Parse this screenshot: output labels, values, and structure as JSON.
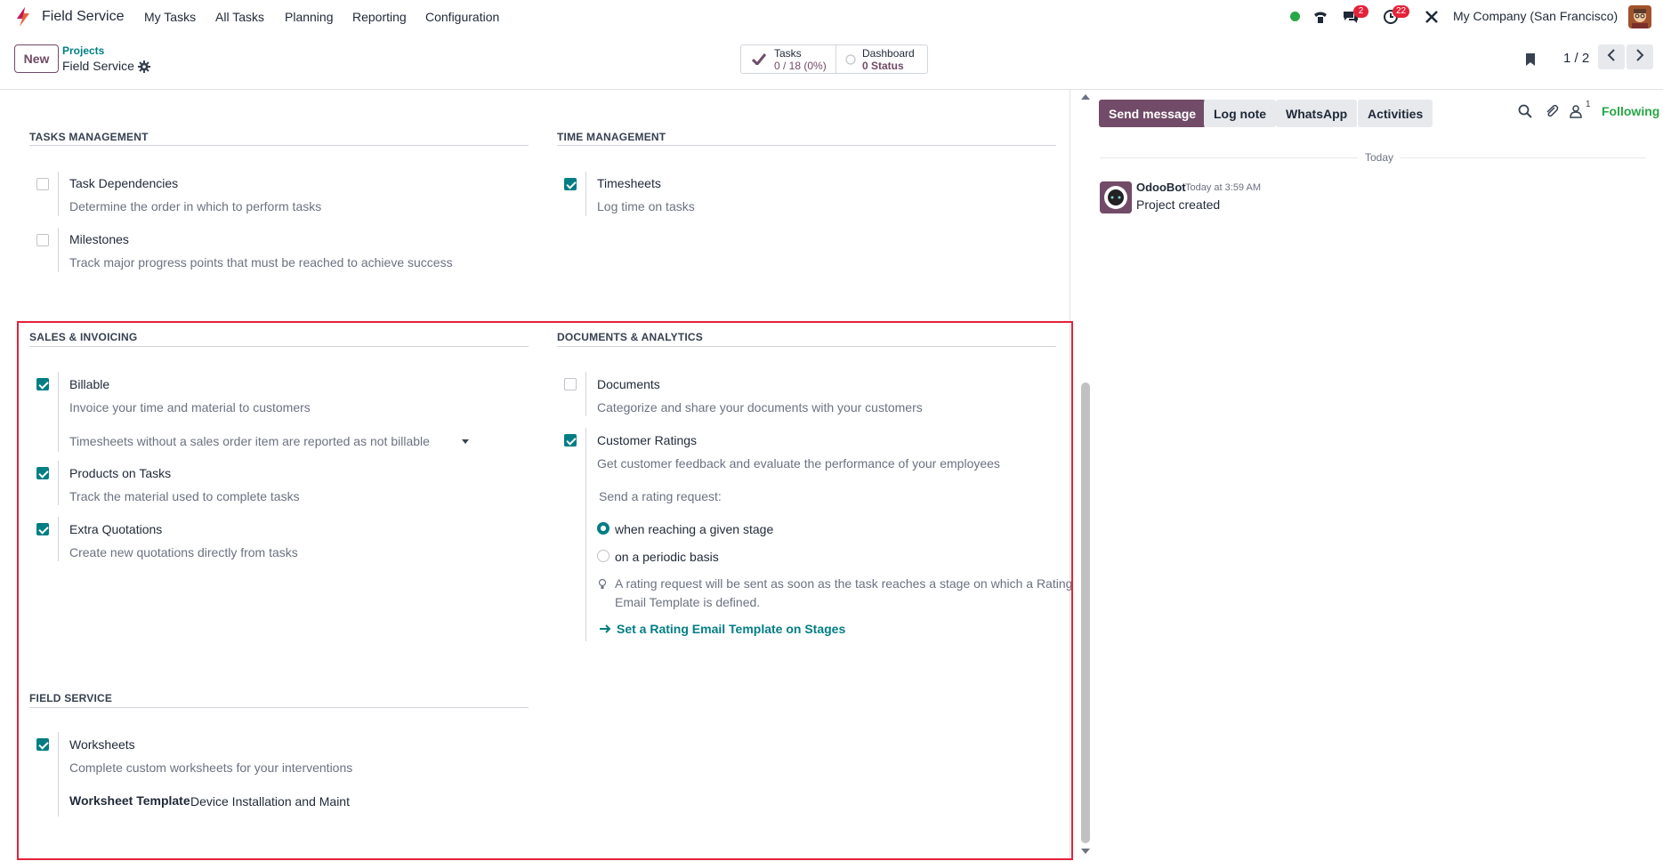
{
  "navbar": {
    "app_name": "Field Service",
    "menus": [
      "My Tasks",
      "All Tasks",
      "Planning",
      "Reporting",
      "Configuration"
    ],
    "messages_badge": "2",
    "activities_badge": "22",
    "company": "My Company (San Francisco)"
  },
  "control": {
    "new_label": "New",
    "breadcrumb_parent": "Projects",
    "breadcrumb_current": "Field Service",
    "tasks_label": "Tasks",
    "tasks_value": "0 / 18 (0%)",
    "dashboard_label": "Dashboard",
    "dashboard_value": "0 Status",
    "pager": "1 / 2"
  },
  "sections": {
    "tasks_management": {
      "title": "TASKS MANAGEMENT",
      "task_dependencies": {
        "title": "Task Dependencies",
        "desc": "Determine the order in which to perform tasks",
        "checked": false
      },
      "milestones": {
        "title": "Milestones",
        "desc": "Track major progress points that must be reached to achieve success",
        "checked": false
      }
    },
    "time_management": {
      "title": "TIME MANAGEMENT",
      "timesheets": {
        "title": "Timesheets",
        "desc": "Log time on tasks",
        "checked": true
      }
    },
    "sales_invoicing": {
      "title": "SALES & INVOICING",
      "billable": {
        "title": "Billable",
        "desc": "Invoice your time and material to customers",
        "checked": true,
        "select_value": "Timesheets without a sales order item are reported as not billable"
      },
      "products_on_tasks": {
        "title": "Products on Tasks",
        "desc": "Track the material used to complete tasks",
        "checked": true
      },
      "extra_quotations": {
        "title": "Extra Quotations",
        "desc": "Create new quotations directly from tasks",
        "checked": true
      }
    },
    "documents_analytics": {
      "title": "DOCUMENTS & ANALYTICS",
      "documents": {
        "title": "Documents",
        "desc": "Categorize and share your documents with your customers",
        "checked": false
      },
      "customer_ratings": {
        "title": "Customer Ratings",
        "desc": "Get customer feedback and evaluate the performance of your employees",
        "checked": true,
        "rating_request_label": "Send a rating request:",
        "options": [
          "when reaching a given stage",
          "on a periodic basis"
        ],
        "selected": "when reaching a given stage",
        "hint": "A rating request will be sent as soon as the task reaches a stage on which a Rating Email Template is defined.",
        "link": "Set a Rating Email Template on Stages"
      }
    },
    "field_service": {
      "title": "FIELD SERVICE",
      "worksheets": {
        "title": "Worksheets",
        "desc": "Complete custom worksheets for your interventions",
        "checked": true,
        "template_label": "Worksheet Template",
        "template_value": "Device Installation and Maint"
      }
    }
  },
  "chatter": {
    "send_message": "Send message",
    "log_note": "Log note",
    "whatsapp": "WhatsApp",
    "activities": "Activities",
    "followers_count": "1",
    "following": "Following",
    "day": "Today",
    "message": {
      "author": "OdooBot",
      "time": "Today at 3:59 AM",
      "body": "Project created"
    }
  },
  "colors": {
    "accent": "#714b67",
    "teal": "#017e84",
    "highlight": "#e4223a",
    "online": "#28a745"
  }
}
